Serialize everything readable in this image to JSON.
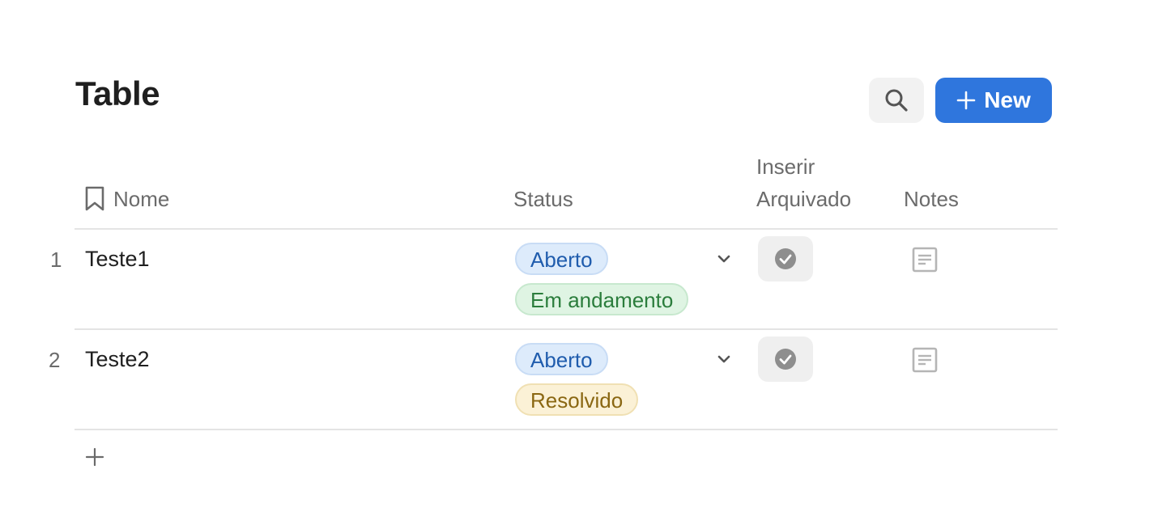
{
  "title": "Table",
  "toolbar": {
    "search_icon": "search-icon",
    "new_label": "New"
  },
  "columns": {
    "name": "Nome",
    "status": "Status",
    "archive_line1": "Inserir",
    "archive_line2": "Arquivado",
    "notes": "Notes"
  },
  "rows": [
    {
      "index": "1",
      "name": "Teste1",
      "tags": [
        "Aberto",
        "Em andamento"
      ]
    },
    {
      "index": "2",
      "name": "Teste2",
      "tags": [
        "Aberto",
        "Resolvido"
      ]
    }
  ],
  "colors": {
    "accent": "#2f76dd",
    "tag_blue": "#ddebfb",
    "tag_green": "#dff4e3",
    "tag_yellow": "#fbf1d6"
  }
}
